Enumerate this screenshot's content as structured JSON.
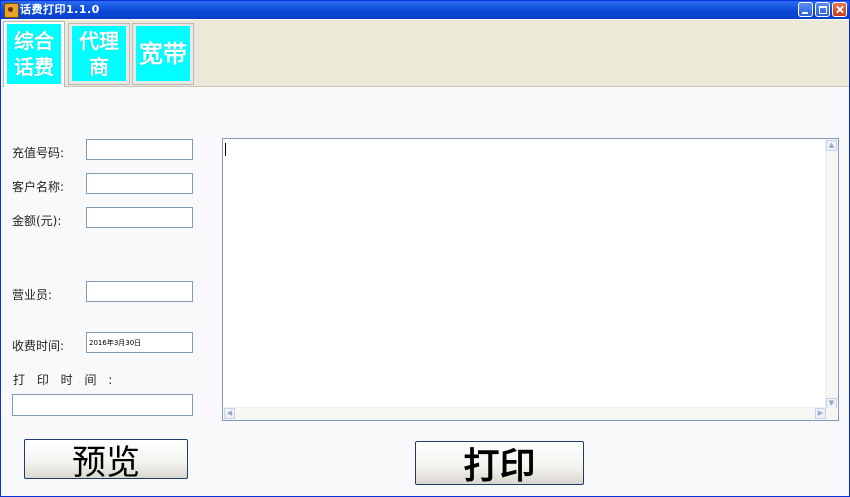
{
  "window": {
    "title": "话费打印1.1.0"
  },
  "tabs": [
    {
      "label": "综合\n话费",
      "active": true
    },
    {
      "label": "代理\n商",
      "active": false
    },
    {
      "label": "宽带",
      "active": false
    }
  ],
  "form": {
    "recharge_number_label": "充值号码:",
    "customer_name_label": "客户名称:",
    "amount_label": "金额(元):",
    "salesperson_label": "营业员:",
    "charge_time_label": "收费时间:",
    "charge_time_value": "2016年3月30日",
    "print_time_label": "打 印 时 间 :"
  },
  "buttons": {
    "preview": "预览",
    "print": "打印"
  },
  "colors": {
    "tab_face": "#00ffff",
    "titlebar": "#0a48d8"
  }
}
